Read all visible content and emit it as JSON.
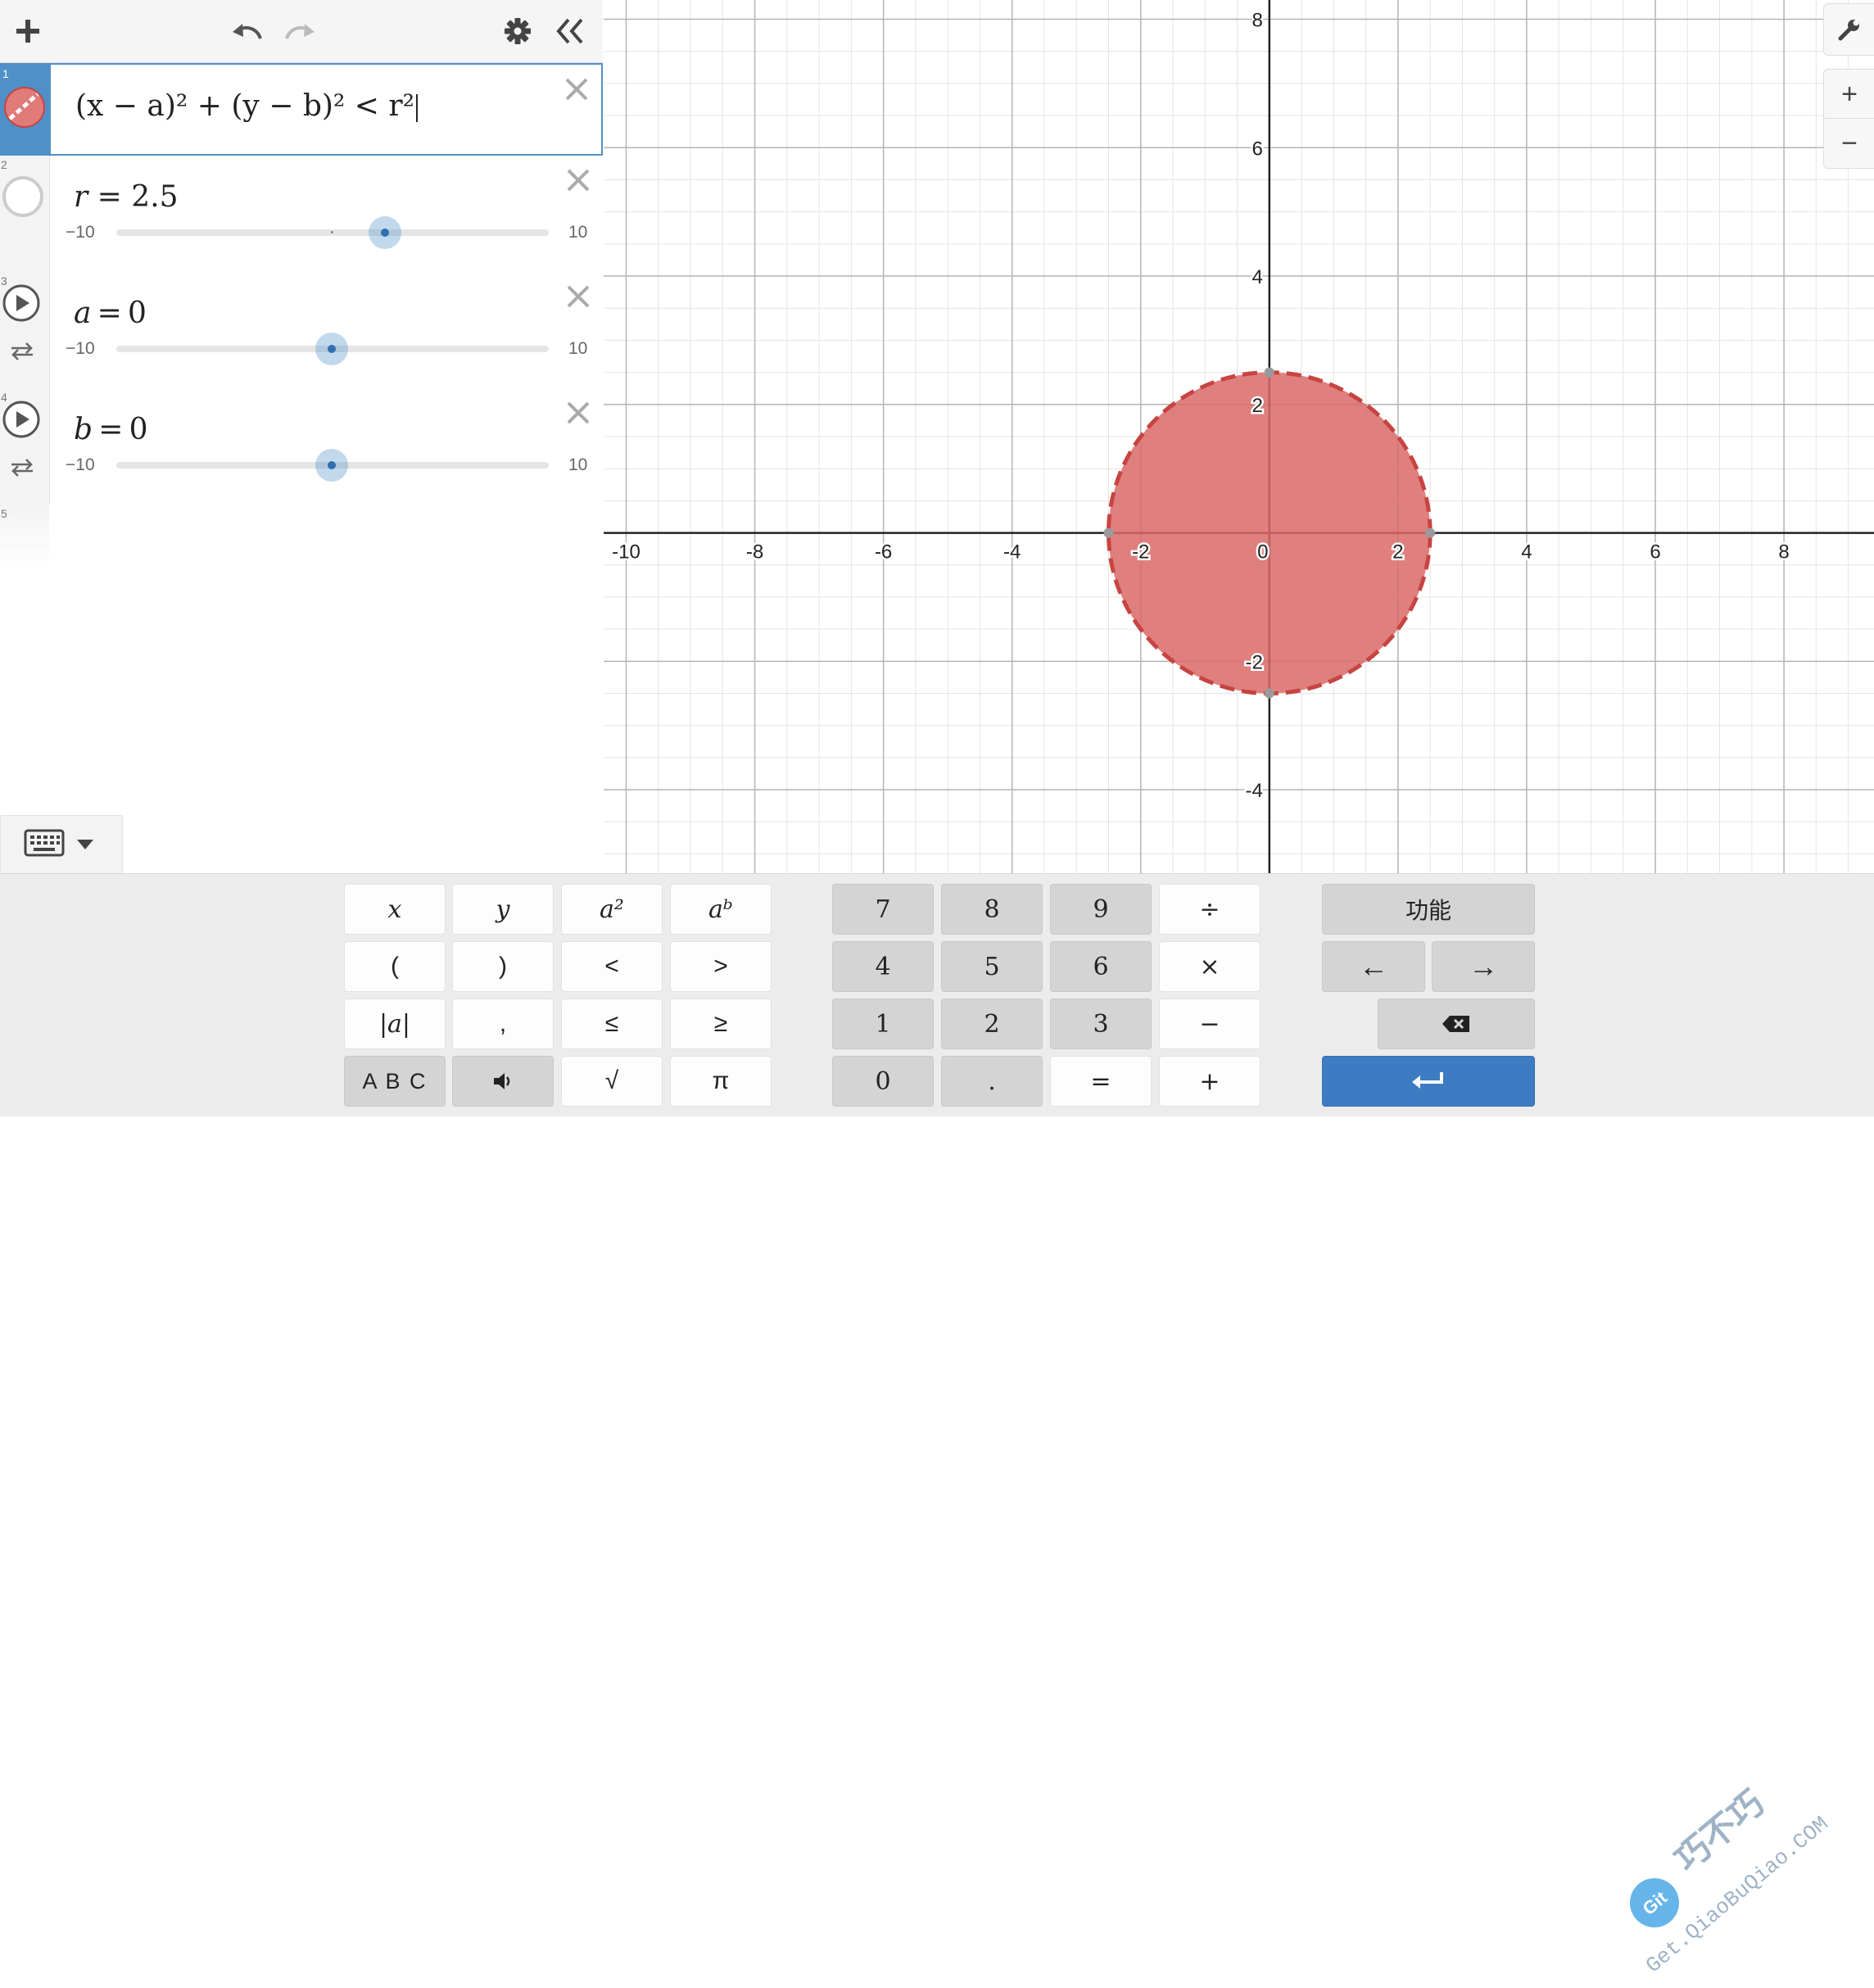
{
  "toolbar": {
    "add_icon": "plus-icon",
    "undo_icon": "undo-icon",
    "redo_icon": "redo-icon",
    "settings_icon": "gear-icon",
    "collapse_icon": "double-chevron-left-icon"
  },
  "expressions": [
    {
      "index": "1",
      "latex_text": "(x − a)² + (y − b)² < r²",
      "color": "#c74440"
    },
    {
      "index": "2",
      "name": "r",
      "eq": "=",
      "value": "2.5",
      "min": "−10",
      "max": "10"
    },
    {
      "index": "3",
      "name": "a",
      "eq": "=",
      "value": "0",
      "min": "−10",
      "max": "10"
    },
    {
      "index": "4",
      "name": "b",
      "eq": "=",
      "value": "0",
      "min": "−10",
      "max": "10"
    },
    {
      "index": "5"
    }
  ],
  "graph": {
    "x_ticks": [
      "-10",
      "-8",
      "-6",
      "-4",
      "-2",
      "0",
      "2",
      "4",
      "6",
      "8"
    ],
    "y_ticks": [
      "8",
      "6",
      "4",
      "2",
      "-2",
      "-4"
    ],
    "x_range": [
      -10.35,
      9.4
    ],
    "y_range": [
      -5.3,
      8.3
    ],
    "grid": true,
    "shape": {
      "type": "disk",
      "center": [
        0,
        0
      ],
      "radius": 2.5,
      "fill": "#d96a69",
      "stroke": "#c74440",
      "stroke_style": "dashed"
    }
  },
  "right_controls": {
    "wrench_icon": "wrench-icon",
    "zoom_in": "+",
    "zoom_out": "−"
  },
  "keypad": {
    "left": [
      [
        "x",
        "y",
        "a²",
        "aᵇ"
      ],
      [
        "(",
        ")",
        "<",
        ">"
      ],
      [
        "|a|",
        ",",
        "≤",
        "≥"
      ],
      [
        "A B C",
        "speaker-icon",
        "√",
        "π"
      ]
    ],
    "mid": [
      [
        "7",
        "8",
        "9",
        "÷"
      ],
      [
        "4",
        "5",
        "6",
        "×"
      ],
      [
        "1",
        "2",
        "3",
        "−"
      ],
      [
        "0",
        ".",
        "=",
        "+"
      ]
    ],
    "func_label": "功能",
    "left_arrow": "←",
    "right_arrow": "→",
    "backspace_icon": "backspace-icon",
    "enter_icon": "enter-icon"
  },
  "watermark": {
    "brand": "巧不巧",
    "url": "Get.QiaoBuQiao.COM",
    "badge": "Git"
  }
}
